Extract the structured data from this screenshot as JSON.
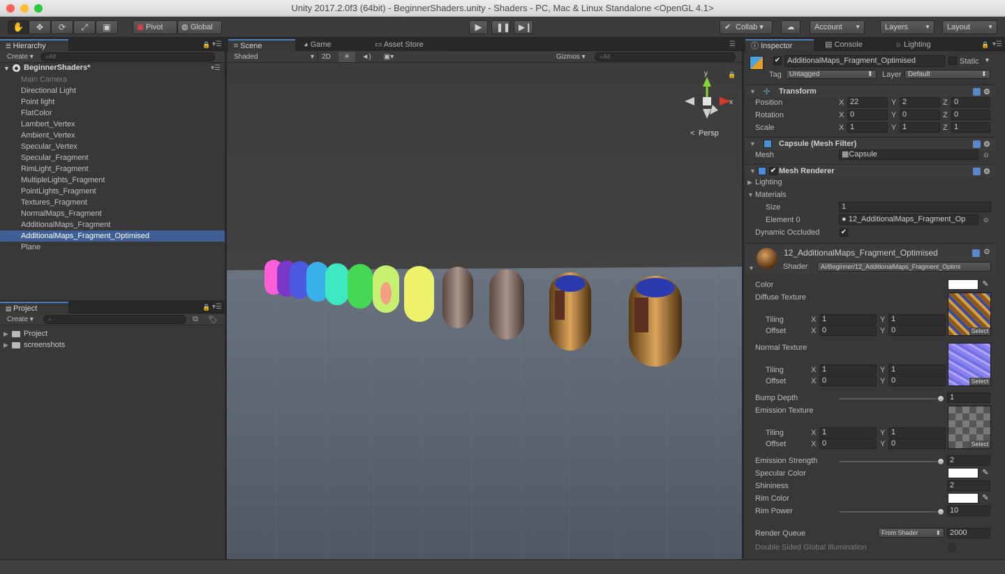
{
  "window": {
    "title": "Unity 2017.2.0f3 (64bit) - BeginnerShaders.unity - Shaders - PC, Mac & Linux Standalone <OpenGL 4.1>"
  },
  "toolbar": {
    "pivot": "Pivot",
    "global": "Global",
    "collab": "Collab ▾",
    "account": "Account",
    "layers": "Layers",
    "layout": "Layout"
  },
  "hierarchy": {
    "tab": "Hierarchy",
    "create": "Create",
    "search_placeholder": "All",
    "scene": "BeginnerShaders*",
    "items": [
      "Main Camera",
      "Directional Light",
      "Point light",
      "FlatColor",
      "Lambert_Vertex",
      "Ambient_Vertex",
      "Specular_Vertex",
      "Specular_Fragment",
      "RimLight_Fragment",
      "MultipleLights_Fragment",
      "PointLights_Fragment",
      "Textures_Fragment",
      "NormalMaps_Fragment",
      "AdditionalMaps_Fragment",
      "AdditionalMaps_Fragment_Optimised",
      "Plane"
    ]
  },
  "project": {
    "tab": "Project",
    "create": "Create",
    "folders": [
      "Project",
      "screenshots"
    ]
  },
  "scene": {
    "tabs": [
      "Scene",
      "Game",
      "Asset Store"
    ],
    "shading": "Shaded",
    "mode2d": "2D",
    "gizmos": "Gizmos",
    "search_placeholder": "All",
    "persp": "Persp",
    "axis_y": "y",
    "axis_x": "x"
  },
  "inspector": {
    "tabs": [
      "Inspector",
      "Console",
      "Lighting"
    ],
    "object_name": "AdditionalMaps_Fragment_Optimised",
    "static": "Static",
    "tag_label": "Tag",
    "tag": "Untagged",
    "layer_label": "Layer",
    "layer": "Default",
    "transform": {
      "title": "Transform",
      "rows": [
        {
          "label": "Position",
          "x": "22",
          "y": "2",
          "z": "0"
        },
        {
          "label": "Rotation",
          "x": "0",
          "y": "0",
          "z": "0"
        },
        {
          "label": "Scale",
          "x": "1",
          "y": "1",
          "z": "1"
        }
      ]
    },
    "mesh_filter": {
      "title": "Capsule (Mesh Filter)",
      "mesh_label": "Mesh",
      "mesh": "Capsule"
    },
    "mesh_renderer": {
      "title": "Mesh Renderer",
      "lighting": "Lighting",
      "materials": "Materials",
      "size_label": "Size",
      "size": "1",
      "element_label": "Element 0",
      "element": "12_AdditionalMaps_Fragment_Op",
      "dynamic_occluded": "Dynamic Occluded"
    },
    "material": {
      "name": "12_AdditionalMaps_Fragment_Optimised",
      "shader_label": "Shader",
      "shader": "Ai/Beginner/12_AdditionalMaps_Fragment_Optimi",
      "color": "Color",
      "diffuse": "Diffuse Texture",
      "normal": "Normal Texture",
      "emission_tex": "Emission Texture",
      "tiling": "Tiling",
      "offset": "Offset",
      "x": "X",
      "y": "Y",
      "diffuse_tiling": [
        "1",
        "1"
      ],
      "diffuse_offset": [
        "0",
        "0"
      ],
      "normal_tiling": [
        "1",
        "1"
      ],
      "normal_offset": [
        "0",
        "0"
      ],
      "emission_tiling": [
        "1",
        "1"
      ],
      "emission_offset": [
        "0",
        "0"
      ],
      "bump_label": "Bump Depth",
      "bump": "1",
      "emission_strength_label": "Emission Strength",
      "emission_strength": "2",
      "specular_color": "Specular Color",
      "shininess_label": "Shininess",
      "shininess": "2",
      "rim_color": "Rim Color",
      "rim_power_label": "Rim Power",
      "rim_power": "10",
      "render_queue_label": "Render Queue",
      "render_queue_mode": "From Shader",
      "render_queue": "2000",
      "double_sided": "Double Sided Global Illumination",
      "select": "Select"
    }
  },
  "colors": {
    "accent": "#3e5f96",
    "background": "#383838"
  }
}
